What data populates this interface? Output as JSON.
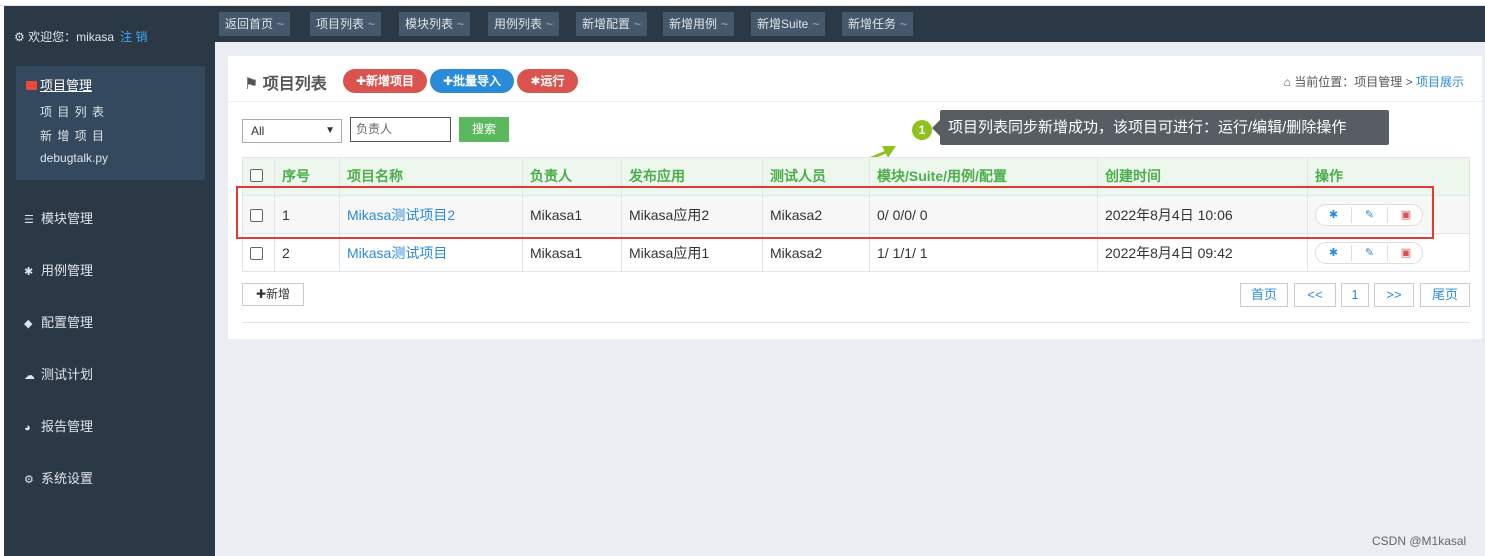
{
  "sidebar": {
    "welcome": "欢迎您：mikasa",
    "logout": "注 销",
    "active_group": {
      "label": "项目管理",
      "items": [
        "项 目 列 表",
        "新 增 项 目",
        "debugtalk.py"
      ]
    },
    "items": [
      {
        "label": "模块管理",
        "icon": "list-icon"
      },
      {
        "label": "用例管理",
        "icon": "bug-icon"
      },
      {
        "label": "配置管理",
        "icon": "tags-icon"
      },
      {
        "label": "测试计划",
        "icon": "cloud-icon"
      },
      {
        "label": "报告管理",
        "icon": "dashboard-icon"
      },
      {
        "label": "系统设置",
        "icon": "cogs-icon"
      }
    ]
  },
  "tabs": [
    "返回首页",
    "项目列表",
    "模块列表",
    "用例列表",
    "新增配置",
    "新增用例",
    "新增Suite",
    "新增任务"
  ],
  "panel": {
    "title": "项目列表",
    "buttons": {
      "new_project": "✚新增项目",
      "batch_import": "✚批量导入",
      "run": "运行"
    },
    "breadcrumb": {
      "prefix": "当前位置：",
      "parent": "项目管理",
      "sep": " > ",
      "current": "项目展示"
    }
  },
  "filter": {
    "select_value": "All",
    "input_placeholder": "负责人",
    "search_label": "搜索"
  },
  "tip": {
    "badge": "1",
    "text": "项目列表同步新增成功，该项目可进行：运行/编辑/删除操作"
  },
  "table": {
    "headers": [
      "序号",
      "项目名称",
      "负责人",
      "发布应用",
      "测试人员",
      "模块/Suite/用例/配置",
      "创建时间",
      "操作"
    ],
    "rows": [
      {
        "index": "1",
        "name": "Mikasa测试项目2",
        "owner": "Mikasa1",
        "app": "Mikasa应用2",
        "tester": "Mikasa2",
        "counts": "0/ 0/0/ 0",
        "created": "2022年8月4日 10:06"
      },
      {
        "index": "2",
        "name": "Mikasa测试项目",
        "owner": "Mikasa1",
        "app": "Mikasa应用1",
        "tester": "Mikasa2",
        "counts": "1/ 1/1/ 1",
        "created": "2022年8月4日 09:42"
      }
    ]
  },
  "add_label": "✚新增",
  "pager": {
    "first": "首页",
    "prev": "<<",
    "page": "1",
    "next": ">>",
    "last": "尾页"
  },
  "watermark": "CSDN @M1kasal",
  "colors": {
    "sidebar_bg": "#2b3947",
    "tab_bg": "#46586b",
    "danger": "#d9534f",
    "primary": "#2a8bd8",
    "success": "#5cb85c",
    "highlight": "#e53935"
  }
}
